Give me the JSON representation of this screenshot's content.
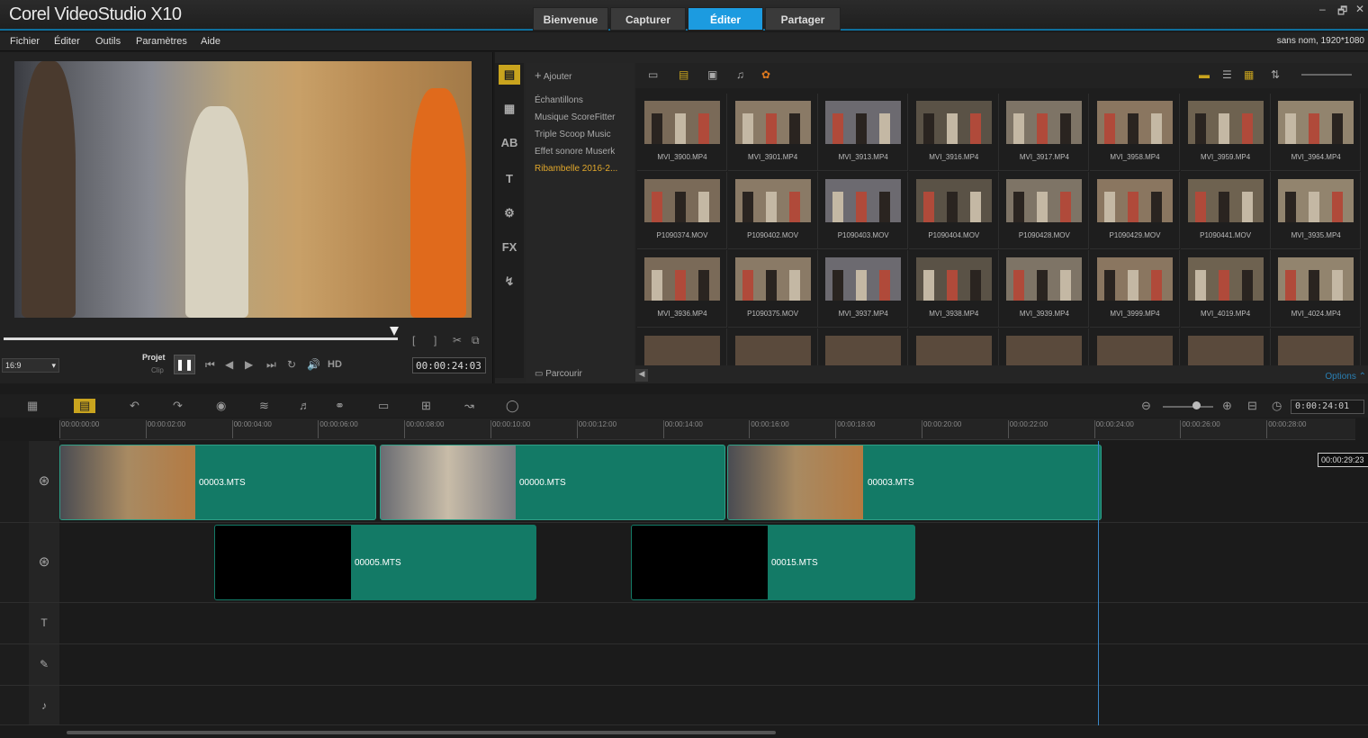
{
  "app": {
    "title": "Corel VideoStudio X10",
    "project_info": "sans nom, 1920*1080"
  },
  "tabs": [
    "Bienvenue",
    "Capturer",
    "Éditer",
    "Partager"
  ],
  "window_controls": [
    "–",
    "🗗",
    "✕"
  ],
  "menu": [
    "Fichier",
    "Éditer",
    "Outils",
    "Paramètres",
    "Aide"
  ],
  "player": {
    "aspect": "16:9",
    "project_label": "Projet",
    "clip_label": "Clip",
    "timecode": "00:00:24:03",
    "hd_label": "HD"
  },
  "library": {
    "add_label": "Ajouter",
    "folders": [
      "Échantillons",
      "Musique ScoreFitter",
      "Triple Scoop Music",
      "Effet sonore Muserk",
      "Ribambelle 2016-2..."
    ],
    "selected_folder": 4,
    "browse_label": "Parcourir",
    "options_label": "Options",
    "items": [
      "MVI_3900.MP4",
      "MVI_3901.MP4",
      "MVI_3913.MP4",
      "MVI_3916.MP4",
      "MVI_3917.MP4",
      "MVI_3958.MP4",
      "MVI_3959.MP4",
      "MVI_3964.MP4",
      "P1090374.MOV",
      "P1090402.MOV",
      "P1090403.MOV",
      "P1090404.MOV",
      "P1090428.MOV",
      "P1090429.MOV",
      "P1090441.MOV",
      "MVI_3935.MP4",
      "MVI_3936.MP4",
      "P1090375.MOV",
      "MVI_3937.MP4",
      "MVI_3938.MP4",
      "MVI_3939.MP4",
      "MVI_3999.MP4",
      "MVI_4019.MP4",
      "MVI_4024.MP4"
    ]
  },
  "timeline": {
    "zoom_timecode": "0:00:24:01",
    "ruler": [
      "00:00:00:00",
      "00:00:02:00",
      "00:00:04:00",
      "00:00:06:00",
      "00:00:08:00",
      "00:00:10:00",
      "00:00:12:00",
      "00:00:14:00",
      "00:00:16:00",
      "00:00:18:00",
      "00:00:20:00",
      "00:00:22:00",
      "00:00:24:00",
      "00:00:26:00",
      "00:00:28:00"
    ],
    "video_clips": [
      "00003.MTS",
      "00000.MTS",
      "00003.MTS"
    ],
    "overlay_clips": [
      "00005.MTS",
      "00015.MTS"
    ],
    "tooltip": "00:00:29:23"
  }
}
